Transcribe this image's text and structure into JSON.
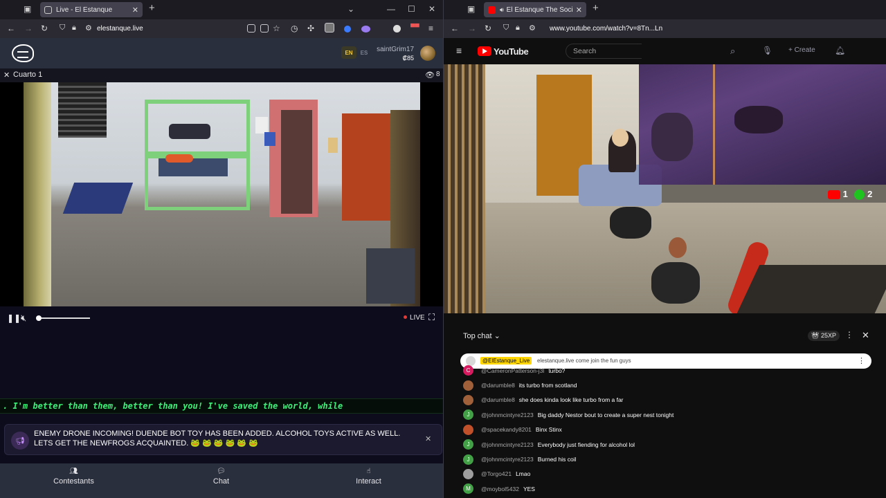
{
  "left_browser": {
    "tab_title": "Live - El Estanque",
    "url": "elestanque.live"
  },
  "right_browser": {
    "tab_title": "El Estanque The Social Experiment",
    "url": "www.youtube.com/watch?v=8Tn...Ln"
  },
  "estanque_site": {
    "lang_active": "EN",
    "lang_other": "ES",
    "username": "saintGrim17",
    "balance": "₡85",
    "room_title": "Cuarto 1",
    "viewer_count": "8",
    "live_label": "LIVE",
    "volume_level": 0,
    "ticker_text": ". I'm better than them, better than you! I've saved the world, while",
    "notice_text": "ENEMY DRONE INCOMING! DUENDE BOT TOY HAS BEEN ADDED. ALCOHOL TOYS ACTIVE AS WELL. LETS GET THE NEWFROGS ACQUAINTED. 🐸 🐸 🐸  🐸 🐸 🐸",
    "nav": [
      {
        "label": "Contestants"
      },
      {
        "label": "Chat"
      },
      {
        "label": "Interact"
      }
    ]
  },
  "youtube": {
    "logo_text": "YouTube",
    "search_placeholder": "Search",
    "create_label": "Create",
    "score_youtube": "1",
    "score_xbox": "2",
    "chat_mode": "Top chat",
    "xp_badge": "25XP",
    "pinned_author": "@ElEstanque_Live",
    "pinned_text": "elestanque.live come join the fun guys",
    "messages": [
      {
        "author": "@CameronPatterson-j3l",
        "text": "turbo?",
        "initial": "C",
        "color": "#d81b60"
      },
      {
        "author": "@darumble8",
        "text": "its turbo from scotland",
        "initial": "",
        "color": "#a0603a"
      },
      {
        "author": "@darumble8",
        "text": "she does kinda look like turbo from a far",
        "initial": "",
        "color": "#a0603a"
      },
      {
        "author": "@johnmcintyre2123",
        "text": "Big daddy Nestor bout to create a super nest tonight",
        "initial": "J",
        "color": "#43a047"
      },
      {
        "author": "@spacekandy8201",
        "text": "Binx Stinx",
        "initial": "",
        "color": "#c0502a"
      },
      {
        "author": "@johnmcintyre2123",
        "text": "Everybody just fiending for alcohol lol",
        "initial": "J",
        "color": "#43a047"
      },
      {
        "author": "@johnmcintyre2123",
        "text": "Burned his coil",
        "initial": "J",
        "color": "#43a047"
      },
      {
        "author": "@Torgo421",
        "text": "Lmao",
        "initial": "",
        "color": "#9e9e9e"
      },
      {
        "author": "@moybol5432",
        "text": "YES",
        "initial": "M",
        "color": "#43a047"
      }
    ]
  }
}
